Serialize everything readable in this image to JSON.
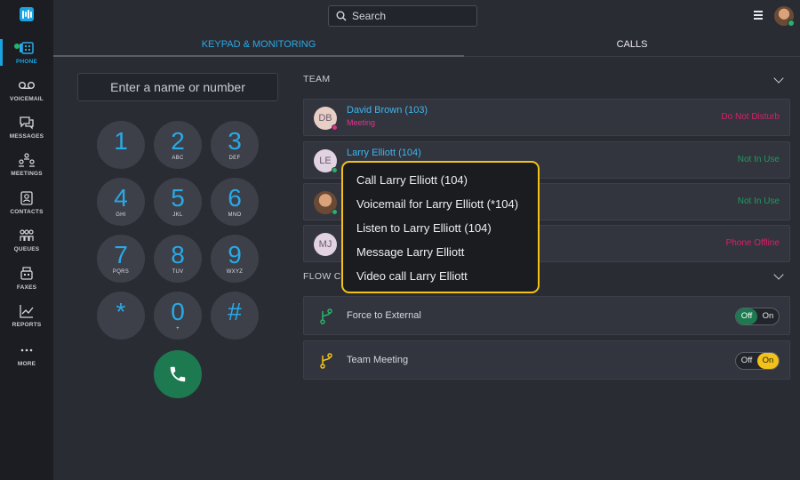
{
  "sidebar": {
    "items": [
      {
        "label": "PHONE",
        "icon": "phone-icon"
      },
      {
        "label": "VOICEMAIL",
        "icon": "voicemail-icon"
      },
      {
        "label": "MESSAGES",
        "icon": "messages-icon"
      },
      {
        "label": "MEETINGS",
        "icon": "meetings-icon"
      },
      {
        "label": "CONTACTS",
        "icon": "contacts-icon"
      },
      {
        "label": "QUEUES",
        "icon": "queues-icon"
      },
      {
        "label": "FAXES",
        "icon": "faxes-icon"
      },
      {
        "label": "REPORTS",
        "icon": "reports-icon"
      },
      {
        "label": "MORE",
        "icon": "more-icon"
      }
    ]
  },
  "header": {
    "search_placeholder": "Search"
  },
  "tabs": [
    {
      "label": "KEYPAD & MONITORING",
      "active": true
    },
    {
      "label": "CALLS",
      "active": false
    }
  ],
  "keypad": {
    "input_placeholder": "Enter a name or number",
    "keys": [
      {
        "digit": "1",
        "letters": ""
      },
      {
        "digit": "2",
        "letters": "ABC"
      },
      {
        "digit": "3",
        "letters": "DEF"
      },
      {
        "digit": "4",
        "letters": "GHI"
      },
      {
        "digit": "5",
        "letters": "JKL"
      },
      {
        "digit": "6",
        "letters": "MNO"
      },
      {
        "digit": "7",
        "letters": "PQRS"
      },
      {
        "digit": "8",
        "letters": "TUV"
      },
      {
        "digit": "9",
        "letters": "WXYZ"
      },
      {
        "digit": "*",
        "letters": ""
      },
      {
        "digit": "0",
        "letters": "+"
      },
      {
        "digit": "#",
        "letters": ""
      }
    ]
  },
  "team": {
    "title": "TEAM",
    "members": [
      {
        "initials": "DB",
        "name": "David Brown (103)",
        "sub": "Meeting",
        "status": "Do Not Disturb",
        "status_color": "#d81f6b",
        "avatar_bg": "#e8cfc6",
        "dot_color": "#e0338b"
      },
      {
        "initials": "LE",
        "name": "Larry Elliott (104)",
        "sub": "",
        "status": "Not In Use",
        "status_color": "#1f9a5e",
        "avatar_bg": "#e2d3e3",
        "dot_color": "#27b36a"
      },
      {
        "initials": "",
        "name": "",
        "sub": "",
        "status": "Not In Use",
        "status_color": "#1f9a5e",
        "avatar_bg": "photo",
        "dot_color": "#27b36a"
      },
      {
        "initials": "MJ",
        "name": "",
        "sub": "",
        "status": "Phone Offline",
        "status_color": "#d81f6b",
        "avatar_bg": "#e2d3e3",
        "dot_color": ""
      }
    ]
  },
  "flow": {
    "title": "FLOW CO",
    "items": [
      {
        "name": "Force to External",
        "off": "Off",
        "on": "On",
        "state": "off",
        "icon_color": "#27b36a"
      },
      {
        "name": "Team Meeting",
        "off": "Off",
        "on": "On",
        "state": "on",
        "icon_color": "#f3c218"
      }
    ]
  },
  "popup_menu": {
    "items": [
      "Call Larry Elliott (104)",
      "Voicemail for Larry Elliott (*104)",
      "Listen to Larry Elliott (104)",
      "Message Larry Elliott",
      "Video call Larry Elliott"
    ]
  },
  "colors": {
    "accent": "#29a9e6",
    "call_button": "#1d7a50",
    "popup_border": "#f3c218",
    "toggle_off_green": "#1d7a50",
    "toggle_on_yellow": "#f3c218"
  }
}
